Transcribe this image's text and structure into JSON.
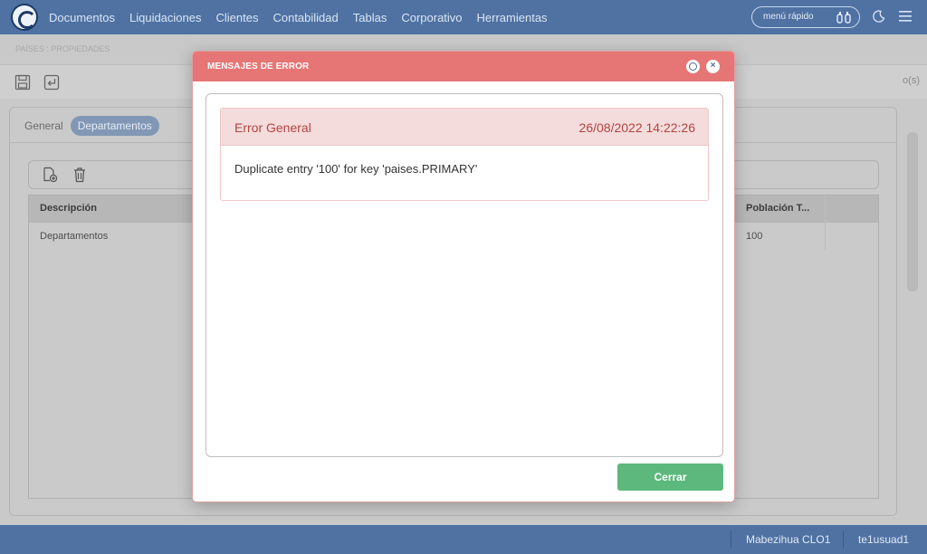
{
  "nav": {
    "items": [
      "Documentos",
      "Liquidaciones",
      "Clientes",
      "Contabilidad",
      "Tablas",
      "Corporativo",
      "Herramientas"
    ],
    "quick_menu_placeholder": "menú rápido"
  },
  "page": {
    "breadcrumb": "PAÍSES : PROPIEDADES",
    "right_hint": "o(s)",
    "tabs": [
      "General",
      "Departamentos"
    ],
    "active_tab": "Departamentos",
    "grid": {
      "columns": [
        "Descripción",
        "Población T..."
      ],
      "rows": [
        [
          "Departamentos",
          "100"
        ]
      ]
    }
  },
  "modal": {
    "title": "MENSAJES DE ERROR",
    "error": {
      "type": "Error General",
      "timestamp": "26/08/2022 14:22:26",
      "message": "Duplicate entry '100' for key 'paises.PRIMARY'"
    },
    "close_label": "Cerrar"
  },
  "status": {
    "company": "Mabezihua CLO1",
    "user": "te1usuad1"
  },
  "colors": {
    "nav_bg": "#4f72a3",
    "modal_header": "#e67575",
    "error_text": "#b2443f",
    "close_button": "#5cb87c"
  }
}
